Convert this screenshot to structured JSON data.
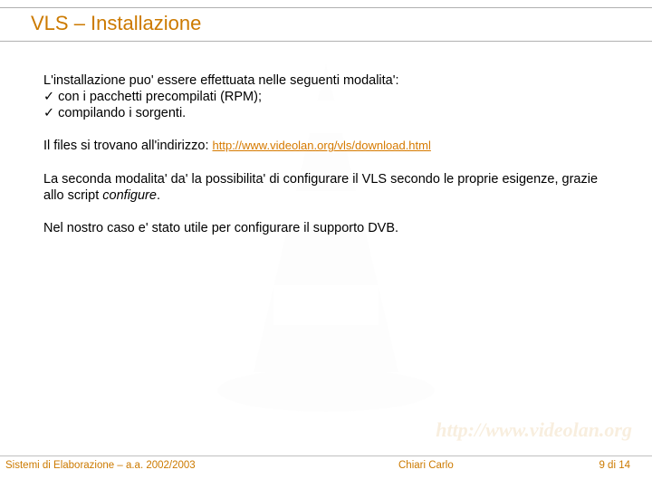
{
  "title": "VLS – Installazione",
  "body": {
    "intro": "L'installazione puo' essere effettuata nelle seguenti modalita':",
    "bullet1": "con i pacchetti precompilati (RPM);",
    "bullet2": "compilando i sorgenti.",
    "files_prefix": "Il files si trovano all'indirizzo: ",
    "files_link": "http://www.videolan.org/vls/download.html",
    "para2a": "La seconda modalita' da' la possibilita' di configurare il VLS secondo le proprie esigenze, grazie allo script ",
    "para2b_italic": "configure",
    "para2c": ".",
    "para3": "Nel nostro caso e' stato utile per configurare il supporto DVB."
  },
  "watermark_url": "http://www.videolan.org",
  "footer": {
    "left": "Sistemi di Elaborazione – a.a. 2002/2003",
    "center": "Chiari Carlo",
    "right": "9 di 14"
  }
}
